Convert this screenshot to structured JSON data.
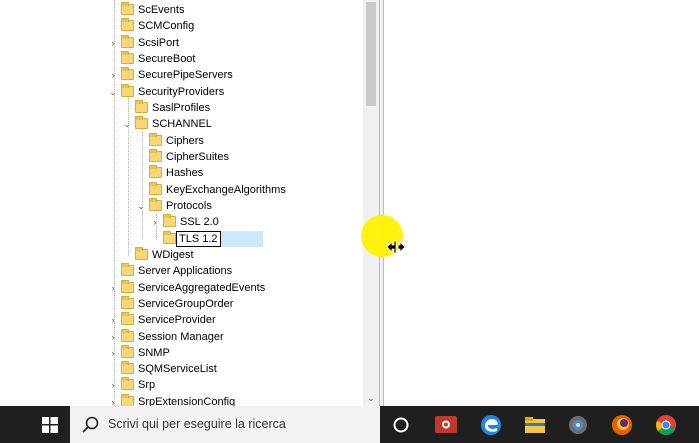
{
  "tree": {
    "items": [
      {
        "label": "ScEvents",
        "chevron": "",
        "selected": false
      },
      {
        "label": "SCMConfig",
        "chevron": "",
        "selected": false
      },
      {
        "label": "ScsiPort",
        "chevron": ">",
        "selected": false
      },
      {
        "label": "SecureBoot",
        "chevron": "",
        "selected": false
      },
      {
        "label": "SecurePipeServers",
        "chevron": ">",
        "selected": false
      },
      {
        "label": "SecurityProviders",
        "chevron": "v",
        "selected": false
      },
      {
        "label": "SaslProfiles",
        "chevron": "",
        "selected": false
      },
      {
        "label": "SCHANNEL",
        "chevron": "v",
        "selected": false
      },
      {
        "label": "Ciphers",
        "chevron": "",
        "selected": false
      },
      {
        "label": "CipherSuites",
        "chevron": "",
        "selected": false
      },
      {
        "label": "Hashes",
        "chevron": "",
        "selected": false
      },
      {
        "label": "KeyExchangeAlgorithms",
        "chevron": "",
        "selected": false
      },
      {
        "label": "Protocols",
        "chevron": "v",
        "selected": false
      },
      {
        "label": "SSL 2.0",
        "chevron": ">",
        "selected": false
      },
      {
        "label": "TLS 1.2",
        "chevron": "",
        "selected": true
      },
      {
        "label": "WDigest",
        "chevron": "",
        "selected": false
      },
      {
        "label": "Server Applications",
        "chevron": "",
        "selected": false
      },
      {
        "label": "ServiceAggregatedEvents",
        "chevron": ">",
        "selected": false
      },
      {
        "label": "ServiceGroupOrder",
        "chevron": "",
        "selected": false
      },
      {
        "label": "ServiceProvider",
        "chevron": ">",
        "selected": false
      },
      {
        "label": "Session Manager",
        "chevron": ">",
        "selected": false
      },
      {
        "label": "SNMP",
        "chevron": ">",
        "selected": false
      },
      {
        "label": "SQMServiceList",
        "chevron": "",
        "selected": false
      },
      {
        "label": "Srp",
        "chevron": ">",
        "selected": false
      },
      {
        "label": "SrpExtensionConfig",
        "chevron": ">",
        "selected": false
      }
    ]
  },
  "taskbar": {
    "search_placeholder": "Scrivi qui per eseguire la ricerca",
    "icons": [
      "start-icon",
      "search-icon",
      "cortana-icon",
      "task-view-icon",
      "edge-icon",
      "file-explorer-icon",
      "settings-icon",
      "firefox-icon",
      "chrome-icon"
    ]
  },
  "colors": {
    "folder": "#f8d775",
    "selection": "#cce8ff",
    "taskbar": "#1f1f1f",
    "cursor_highlight": "#fff200"
  }
}
